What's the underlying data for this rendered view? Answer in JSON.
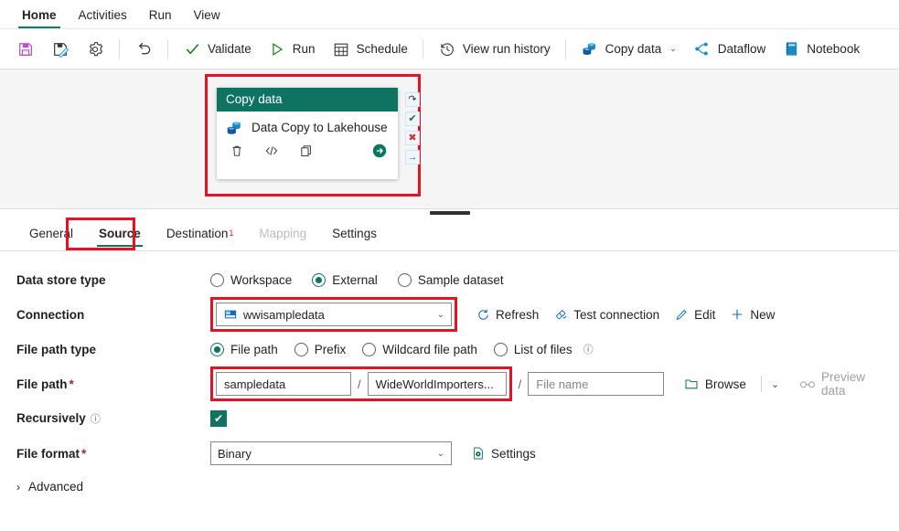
{
  "menu": {
    "items": [
      {
        "label": "Home",
        "active": true
      },
      {
        "label": "Activities",
        "active": false
      },
      {
        "label": "Run",
        "active": false
      },
      {
        "label": "View",
        "active": false
      }
    ]
  },
  "toolbar": {
    "save_icon": "save-icon",
    "save_as_icon": "save-as-icon",
    "settings_icon": "gear-icon",
    "undo_icon": "undo-icon",
    "validate_label": "Validate",
    "run_label": "Run",
    "schedule_label": "Schedule",
    "view_run_history_label": "View run history",
    "copy_data_label": "Copy data",
    "copy_data_caret": "⌄",
    "dataflow_label": "Dataflow",
    "notebook_label": "Notebook"
  },
  "canvas": {
    "activity": {
      "type_label": "Copy data",
      "name": "Data Copy to Lakehouse",
      "icon": "copy-data-icon",
      "tools": {
        "delete_icon": "🗑",
        "code_icon": "</>",
        "duplicate_icon": "⧉",
        "run_icon": "→"
      }
    },
    "connectors": [
      {
        "name": "on-retry",
        "glyph": "↷",
        "color": "#323130"
      },
      {
        "name": "on-success",
        "glyph": "✔",
        "color": "#107c10"
      },
      {
        "name": "on-fail",
        "glyph": "✖",
        "color": "#d13438"
      },
      {
        "name": "on-completion",
        "glyph": "→",
        "color": "#0078d4"
      }
    ]
  },
  "tabs": {
    "items": [
      {
        "label": "General",
        "state": "normal"
      },
      {
        "label": "Source",
        "state": "active"
      },
      {
        "label": "Destination",
        "state": "normal",
        "badge": "1"
      },
      {
        "label": "Mapping",
        "state": "disabled"
      },
      {
        "label": "Settings",
        "state": "normal"
      }
    ]
  },
  "source": {
    "data_store_type": {
      "label": "Data store type",
      "options": [
        "Workspace",
        "External",
        "Sample dataset"
      ],
      "selected": "External"
    },
    "connection": {
      "label": "Connection",
      "value": "wwisampledata",
      "icon": "blob-storage-icon",
      "chevron": "⌄",
      "actions": [
        {
          "label": "Refresh",
          "icon": "refresh-icon"
        },
        {
          "label": "Test connection",
          "icon": "plug-icon"
        },
        {
          "label": "Edit",
          "icon": "pencil-icon"
        },
        {
          "label": "New",
          "icon": "plus-icon"
        }
      ]
    },
    "file_path_type": {
      "label": "File path type",
      "options": [
        "File path",
        "Prefix",
        "Wildcard file path",
        "List of files"
      ],
      "selected": "File path",
      "info_icon": "ⓘ"
    },
    "file_path": {
      "label": "File path",
      "required": "*",
      "container": "sampledata",
      "directory": "WideWorldImporters...",
      "file_name_placeholder": "File name",
      "separator": "/",
      "browse_label": "Browse",
      "browse_caret": "⌄",
      "preview_label": "Preview data",
      "preview_icon": "glasses-icon",
      "browse_icon": "folder-icon"
    },
    "recursively": {
      "label": "Recursively",
      "checked": true,
      "check_glyph": "✔",
      "info_icon": "ⓘ"
    },
    "file_format": {
      "label": "File format",
      "required": "*",
      "value": "Binary",
      "chevron": "⌄",
      "settings_label": "Settings",
      "settings_icon": "file-settings-icon"
    },
    "advanced": {
      "label": "Advanced",
      "chevron": "›"
    }
  },
  "colors": {
    "accent_green": "#0f7362",
    "highlight_red": "#e81123",
    "link_blue": "#0078d4",
    "save_purple": "#bf4cd1"
  }
}
